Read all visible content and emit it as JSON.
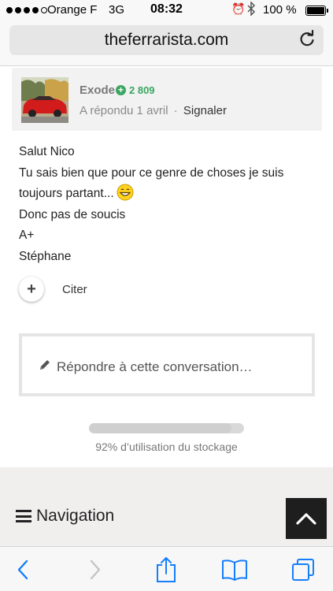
{
  "status_bar": {
    "carrier": "Orange F",
    "network": "3G",
    "time": "08:32",
    "battery": "100 %",
    "signal_dots": 4
  },
  "browser": {
    "url": "theferrarista.com",
    "reload_icon": "reload-icon"
  },
  "post": {
    "author": "Exode",
    "reputation": "2 809",
    "replied": "A répondu 1 avril",
    "separator": "·",
    "report": "Signaler",
    "body_lines": [
      "Salut Nico",
      "Tu sais bien que pour ce genre de choses je suis",
      "toujours partant...",
      "Donc pas de soucis",
      "A+",
      "Stéphane"
    ],
    "plus_label": "+",
    "cite_label": "Citer"
  },
  "reply": {
    "placeholder": "Répondre à cette conversation…"
  },
  "storage": {
    "label": "92% d’utilisation du stockage",
    "fraction": 0.92
  },
  "footer": {
    "navigation_label": "Navigation"
  },
  "colors": {
    "accent_green": "#3aa661",
    "ios_blue": "#157efb",
    "dark_button": "#1e1e1e"
  }
}
